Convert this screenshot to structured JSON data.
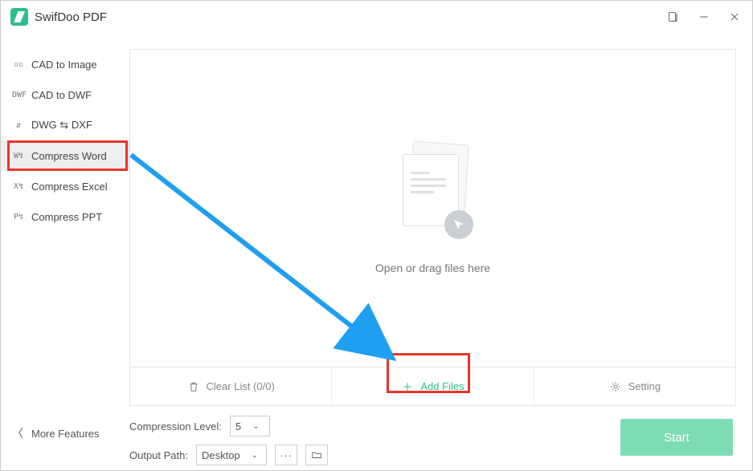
{
  "app": {
    "title": "SwifDoo PDF"
  },
  "sidebar": {
    "items": [
      {
        "label": "CAD to Image",
        "icon": "▫▫"
      },
      {
        "label": "CAD to DWF",
        "icon": "DWF"
      },
      {
        "label": "DWG ⇆ DXF",
        "icon": "⇵"
      },
      {
        "label": "Compress Word",
        "icon": "W↯",
        "selected": true
      },
      {
        "label": "Compress Excel",
        "icon": "X↯"
      },
      {
        "label": "Compress PPT",
        "icon": "P↯"
      }
    ],
    "more": "More Features"
  },
  "drop": {
    "text": "Open or drag files here"
  },
  "actions": {
    "clear": "Clear List (0/0)",
    "add": "Add Files",
    "setting": "Setting"
  },
  "controls": {
    "level_label": "Compression Level:",
    "level_value": "5",
    "path_label": "Output Path:",
    "path_value": "Desktop"
  },
  "start": {
    "label": "Start"
  },
  "colors": {
    "accent": "#2bbf8a",
    "highlight": "#e7352c",
    "arrow": "#1f9ff0"
  }
}
